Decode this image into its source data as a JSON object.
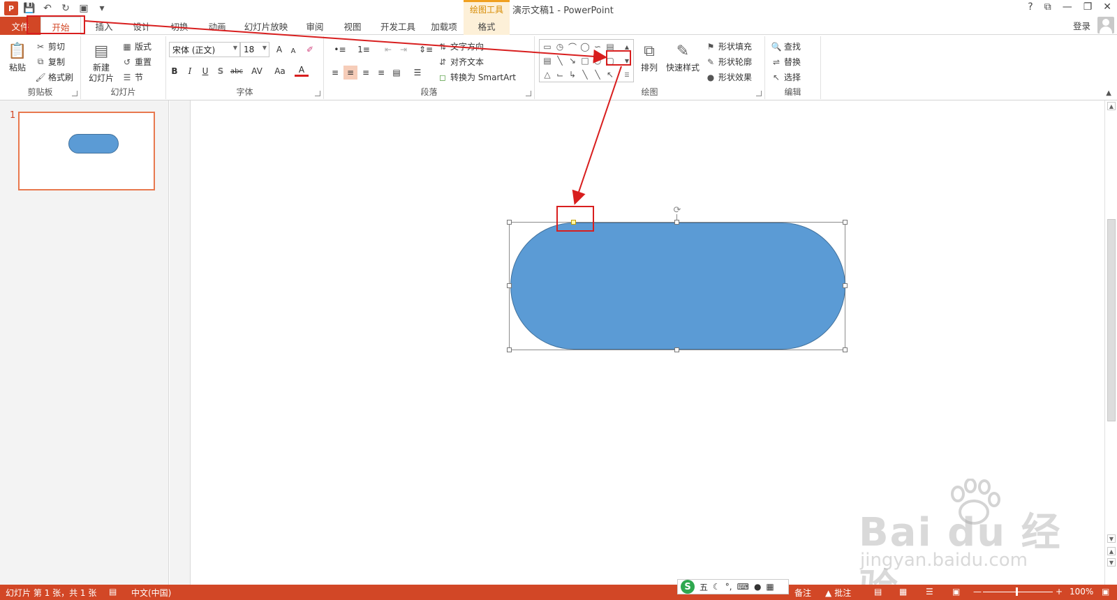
{
  "titlebar": {
    "app_icon": "P",
    "context_tab_group": "绘图工具",
    "document_title": "演示文稿1 - PowerPoint",
    "controls": [
      "?",
      "⧉",
      "—",
      "❐",
      "✕"
    ]
  },
  "tabs": {
    "file": "文件",
    "home": "开始",
    "insert": "插入",
    "design": "设计",
    "transitions": "切换",
    "animations": "动画",
    "slideshow": "幻灯片放映",
    "review": "审阅",
    "view": "视图",
    "developer": "开发工具",
    "addins": "加载项",
    "format": "格式",
    "login": "登录"
  },
  "ribbon": {
    "clipboard": {
      "label": "剪贴板",
      "paste": "粘贴",
      "cut": "剪切",
      "copy": "复制",
      "format_painter": "格式刷"
    },
    "slides": {
      "label": "幻灯片",
      "new_slide_line1": "新建",
      "new_slide_line2": "幻灯片",
      "layout": "版式",
      "reset": "重置",
      "section": "节"
    },
    "font": {
      "label": "字体",
      "font_name": "宋体 (正文)",
      "font_size": "18",
      "bold": "B",
      "italic": "I",
      "underline": "U",
      "shadow": "S",
      "strike": "abc",
      "spacing": "AV",
      "case": "Aa",
      "color": "A",
      "grow": "A",
      "shrink": "A"
    },
    "paragraph": {
      "label": "段落",
      "text_direction": "文字方向",
      "align_text": "对齐文本",
      "smartart": "转换为 SmartArt"
    },
    "drawing": {
      "label": "绘图",
      "arrange": "排列",
      "quick_styles": "快速样式",
      "shape_fill": "形状填充",
      "shape_outline": "形状轮廓",
      "shape_effects": "形状效果"
    },
    "editing": {
      "label": "编辑",
      "find": "查找",
      "replace": "替换",
      "select": "选择"
    }
  },
  "thumbnails": [
    {
      "number": "1"
    }
  ],
  "statusbar": {
    "slide_info": "幻灯片 第 1 张，共 1 张",
    "language": "中文(中国)",
    "notes": "备注",
    "comments": "批注",
    "zoom": "100%"
  },
  "ime": {
    "logo": "S",
    "mode": "五"
  },
  "watermark": {
    "main": "Bai du 经验",
    "sub": "jingyan.baidu.com"
  },
  "colors": {
    "accent": "#d24726",
    "shape_fill": "#5b9bd5",
    "shape_border": "#41719c",
    "highlight": "#d81e1e"
  }
}
